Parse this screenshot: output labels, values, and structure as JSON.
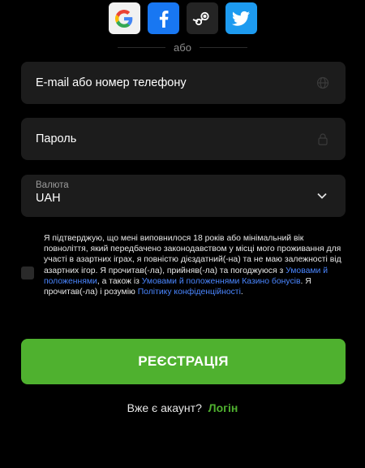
{
  "social": {
    "icons": [
      "google-icon",
      "facebook-icon",
      "steam-icon",
      "twitter-icon"
    ],
    "colors": {
      "google": "#f1f1f1",
      "facebook": "#1877f2",
      "steam": "#242424",
      "twitter": "#1d9bf0"
    }
  },
  "divider_text": "або",
  "email": {
    "placeholder": "E-mail або номер телефону",
    "icon": "globe-icon"
  },
  "password": {
    "placeholder": "Пароль",
    "icon": "lock-icon"
  },
  "currency": {
    "label": "Валюта",
    "value": "UAH",
    "icon": "chevron-down-icon"
  },
  "consent": {
    "text_1": "Я підтверджую, що мені виповнилося 18 років або мінімальний вік повноліття, який передбачено законодавством у місці мого проживання для участі в азартних іграх, я повністю дієздатний(-на) та не маю залежності від азартних ігор. Я прочитав(-ла), прийняв(-ла) та погоджуюся з ",
    "link_1": "Умовами й положеннями",
    "text_2": ", а також із ",
    "link_2": "Умовами й положеннями Казино бонусів",
    "text_3": ". Я прочитав(-ла) і розумію ",
    "link_3": "Політику конфіденційності",
    "text_4": "."
  },
  "register_button": "РЕЄСТРАЦІЯ",
  "login_prompt": {
    "question": "Вже є акаунт?",
    "link": "Логін"
  },
  "colors": {
    "accent": "#4fb12f",
    "link": "#4a86ff",
    "field_bg": "#1c1c1c",
    "background": "#000000"
  }
}
